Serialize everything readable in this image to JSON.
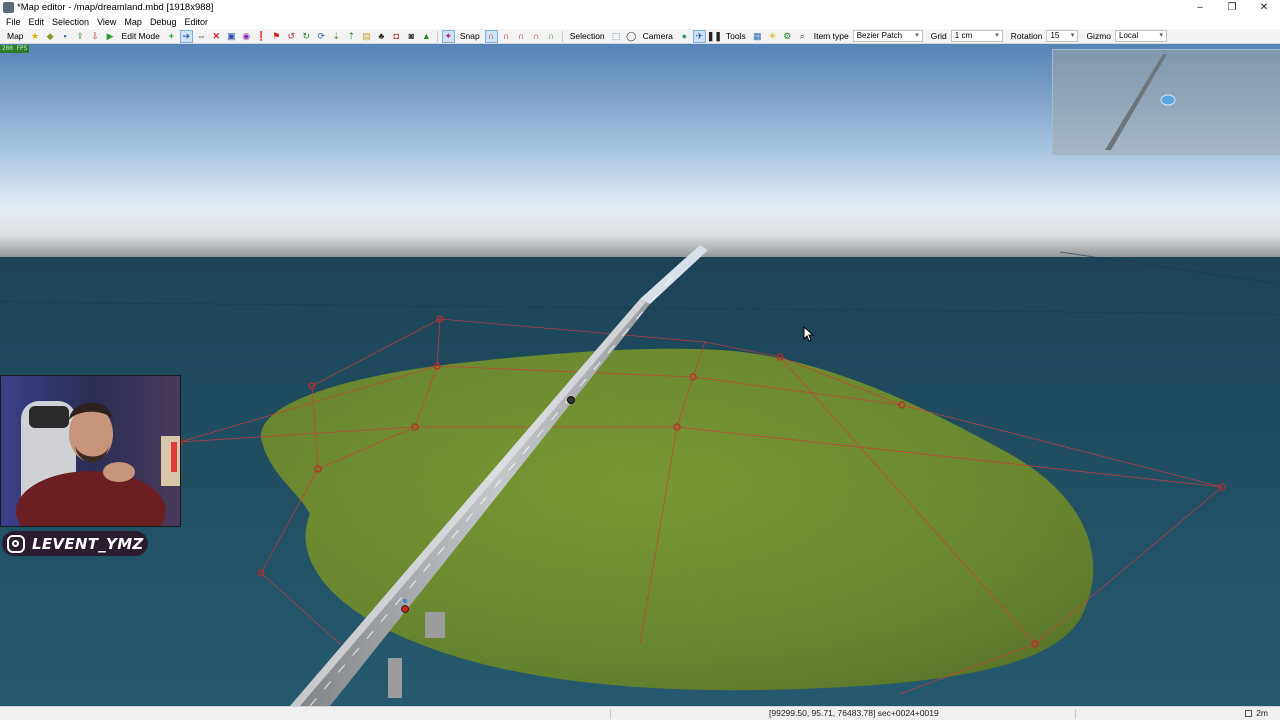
{
  "window": {
    "title": "*Map editor - /map/dreamland.mbd [1918x988]",
    "controls": [
      "–",
      "❐",
      "✕"
    ]
  },
  "menu": {
    "items": [
      "File",
      "Edit",
      "Selection",
      "View",
      "Map",
      "Debug",
      "Editor"
    ]
  },
  "toolbar": {
    "map_label": "Map",
    "edit_mode_label": "Edit Mode",
    "snap_label": "Snap",
    "selection_label": "Selection",
    "camera_label": "Camera",
    "tools_label": "Tools",
    "item_type_label": "Item type",
    "item_type_value": "Bezier Patch",
    "grid_label": "Grid",
    "grid_value": "1 cm",
    "rotation_label": "Rotation",
    "rotation_value": "15",
    "gizmo_label": "Gizmo",
    "gizmo_value": "Local"
  },
  "viewport": {
    "fps": "200 FPS"
  },
  "overlay": {
    "handle": "LEVENT_YMZ"
  },
  "status": {
    "coords": "[99299.50, 95.71, 76483.78] sec+0024+0019",
    "time": "2m"
  },
  "colors": {
    "sky_top": "#5a86b8",
    "sky_horizon": "#eef2f6",
    "water": "#1f4a5c",
    "grass": "#6c8a28",
    "control_line": "#d03a3a",
    "road": "#b9bcbf"
  }
}
